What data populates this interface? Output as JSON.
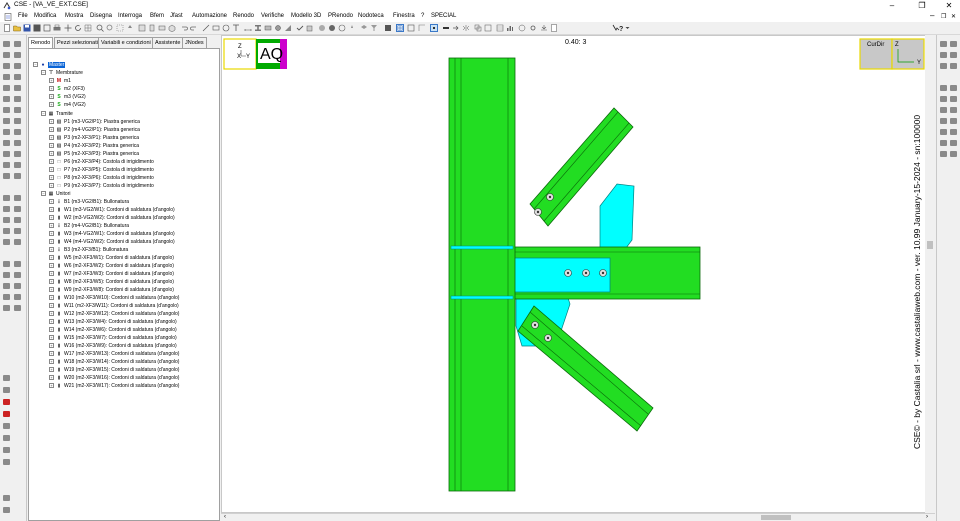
{
  "window": {
    "title": "CSE - [VA_VE_EXT.CSE]"
  },
  "menu": [
    "File",
    "Modifica",
    "Mostra",
    "Disegna",
    "Interroga",
    "Bfem",
    "Jfast",
    "Automazione",
    "Renodo",
    "Verifiche",
    "Modello 3D",
    "PRenodo",
    "Nodoteca",
    "Finestra",
    "?",
    "SPECIAL"
  ],
  "tabs": [
    "Renodo",
    "Pezzi selezionati",
    "Variabili e condizioni",
    "Assistente",
    "JNodes"
  ],
  "tree": {
    "root": "Master",
    "membrature": {
      "label": "Membrature",
      "items": [
        "m1",
        "m2 (XF3)",
        "m3 (VG2)",
        "m4 (VG2)"
      ]
    },
    "tramite": {
      "label": "Tramite",
      "items": [
        "P1 (m3-VG2/P1): Piastra generica",
        "P2 (m4-VG2/P1): Piastra generica",
        "P3 (m2-XF3/P1): Piastra generica",
        "P4 (m2-XF3/P2): Piastra generica",
        "P5 (m2-XF3/P3): Piastra generica",
        "P6 (m2-XF3/P4): Costola di irrigidimento",
        "P7 (m2-XF3/P5): Costola di irrigidimento",
        "P8 (m2-XF3/P6): Costola di irrigidimento",
        "P9 (m2-XF3/P7): Costola di irrigidimento"
      ]
    },
    "unitori": {
      "label": "Unitori",
      "items": [
        "B1 (m3-VG2/B1): Bullonatura",
        "W1 (m3-VG2/W1): Cordoni di saldatura (d'angolo)",
        "W2 (m3-VG2/W2): Cordoni di saldatura (d'angolo)",
        "B2 (m4-VG2/B1): Bullonatura",
        "W3 (m4-VG2/W1): Cordoni di saldatura (d'angolo)",
        "W4 (m4-VG2/W2): Cordoni di saldatura (d'angolo)",
        "B3 (m2-XF3/B1): Bullonatura",
        "W5 (m2-XF3/W1): Cordoni di saldatura (d'angolo)",
        "W6 (m2-XF3/W2): Cordoni di saldatura (d'angolo)",
        "W7 (m2-XF3/W3): Cordoni di saldatura (d'angolo)",
        "W8 (m2-XF3/W5): Cordoni di saldatura (d'angolo)",
        "W9 (m2-XF3/W8): Cordoni di saldatura (d'angolo)",
        "W10 (m2-XF3/W10): Cordoni di saldatura (d'angolo)",
        "W11 (m2-XF3/W11): Cordoni di saldatura (d'angolo)",
        "W12 (m2-XF3/W12): Cordoni di saldatura (d'angolo)",
        "W13 (m2-XF3/W4): Cordoni di saldatura (d'angolo)",
        "W14 (m2-XF3/W6): Cordoni di saldatura (d'angolo)",
        "W15 (m2-XF3/W7): Cordoni di saldatura (d'angolo)",
        "W16 (m2-XF3/W9): Cordoni di saldatura (d'angolo)",
        "W17 (m2-XF3/W13): Cordoni di saldatura (d'angolo)",
        "W18 (m2-XF3/W14): Cordoni di saldatura (d'angolo)",
        "W19 (m2-XF3/W15): Cordoni di saldatura (d'angolo)",
        "W20 (m2-XF3/W16): Cordoni di saldatura (d'angolo)",
        "W21 (m2-XF3/W17): Cordoni di saldatura (d'angolo)"
      ]
    }
  },
  "viewport": {
    "coord_readout": "0.40: 3",
    "view_badge": "AQ",
    "curdir_label": "CurDir",
    "axis_z": "Z",
    "axis_x": "X",
    "axis_y": "Y",
    "signature": "CSE© - by Castalia srl - www.castaliaweb.com - ver. 10.99 January-15-2024 - sn:100000"
  },
  "colors": {
    "member": "#22dd22",
    "member_edge": "#0a6a0a",
    "plate": "#00ffff",
    "plate_edge": "#008080",
    "badge_bg": "#00aa00",
    "badge_accent": "#cc00cc",
    "highlight": "#ffff00"
  }
}
